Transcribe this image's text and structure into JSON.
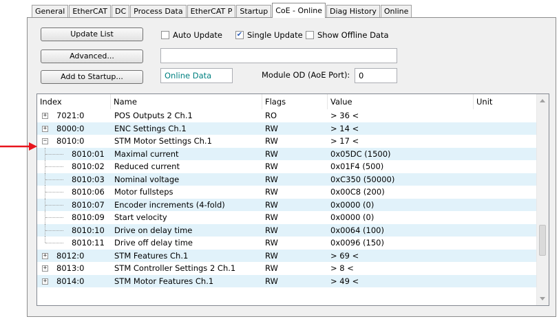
{
  "tabs": [
    "General",
    "EtherCAT",
    "DC",
    "Process Data",
    "EtherCAT P",
    "Startup",
    "CoE - Online",
    "Diag History",
    "Online"
  ],
  "active_tab": "CoE - Online",
  "toolbar": {
    "update_list": "Update List",
    "advanced": "Advanced...",
    "add_to_startup": "Add to Startup...",
    "auto_update": "Auto Update",
    "single_update": "Single Update",
    "show_offline": "Show Offline Data",
    "online_data": "Online Data",
    "module_od_label": "Module OD (AoE Port):",
    "module_od_value": "0"
  },
  "checkboxes": {
    "auto_update": false,
    "single_update": true,
    "show_offline": false
  },
  "table": {
    "headers": {
      "index": "Index",
      "name": "Name",
      "flags": "Flags",
      "value": "Value",
      "unit": "Unit"
    },
    "rows": [
      {
        "index": "7021:0",
        "name": "POS Outputs 2 Ch.1",
        "flags": "RO",
        "value": "> 36 <",
        "level": 0,
        "expander": "+"
      },
      {
        "index": "8000:0",
        "name": "ENC Settings Ch.1",
        "flags": "RW",
        "value": "> 14 <",
        "level": 0,
        "expander": "+"
      },
      {
        "index": "8010:0",
        "name": "STM Motor Settings Ch.1",
        "flags": "RW",
        "value": "> 17 <",
        "level": 0,
        "expander": "−"
      },
      {
        "index": "8010:01",
        "name": "Maximal current",
        "flags": "RW",
        "value": "0x05DC (1500)",
        "level": 1
      },
      {
        "index": "8010:02",
        "name": "Reduced current",
        "flags": "RW",
        "value": "0x01F4 (500)",
        "level": 1
      },
      {
        "index": "8010:03",
        "name": "Nominal voltage",
        "flags": "RW",
        "value": "0xC350 (50000)",
        "level": 1
      },
      {
        "index": "8010:06",
        "name": "Motor fullsteps",
        "flags": "RW",
        "value": "0x00C8 (200)",
        "level": 1
      },
      {
        "index": "8010:07",
        "name": "Encoder increments (4-fold)",
        "flags": "RW",
        "value": "0x0000 (0)",
        "level": 1
      },
      {
        "index": "8010:09",
        "name": "Start velocity",
        "flags": "RW",
        "value": "0x0000 (0)",
        "level": 1
      },
      {
        "index": "8010:10",
        "name": "Drive on delay time",
        "flags": "RW",
        "value": "0x0064 (100)",
        "level": 1
      },
      {
        "index": "8010:11",
        "name": "Drive off delay time",
        "flags": "RW",
        "value": "0x0096 (150)",
        "level": 1
      },
      {
        "index": "8012:0",
        "name": "STM Features Ch.1",
        "flags": "RW",
        "value": "> 69 <",
        "level": 0,
        "expander": "+"
      },
      {
        "index": "8013:0",
        "name": "STM Controller Settings 2 Ch.1",
        "flags": "RW",
        "value": "> 8 <",
        "level": 0,
        "expander": "+"
      },
      {
        "index": "8014:0",
        "name": "STM Motor Features Ch.1",
        "flags": "RW",
        "value": "> 49 <",
        "level": 0,
        "expander": "+"
      }
    ]
  },
  "colors": {
    "accent_text": "#008080",
    "alt_row": "#e1f2fa",
    "pointer": "#e8141c"
  },
  "icons": {
    "pointer": "red-arrow-icon",
    "scroll_up": "chevron-up-icon",
    "scroll_down": "chevron-down-icon"
  }
}
